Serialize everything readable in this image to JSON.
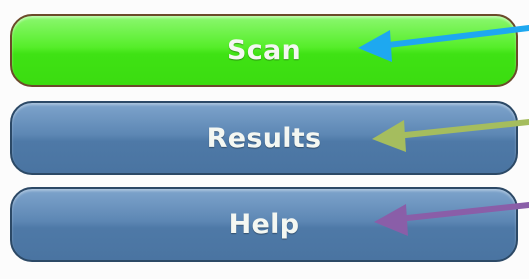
{
  "menu": {
    "scan_label": "Scan",
    "results_label": "Results",
    "help_label": "Help"
  },
  "colors": {
    "scan_button": "#4fea20",
    "results_button": "#5580ad",
    "help_button": "#5580ad",
    "scan_arrow": "#1ea8f0",
    "results_arrow": "#a5bd5e",
    "help_arrow": "#8a5ea8"
  },
  "annotations": {
    "scan_arrow_icon": "arrow-left-icon",
    "results_arrow_icon": "arrow-left-icon",
    "help_arrow_icon": "arrow-left-icon"
  }
}
